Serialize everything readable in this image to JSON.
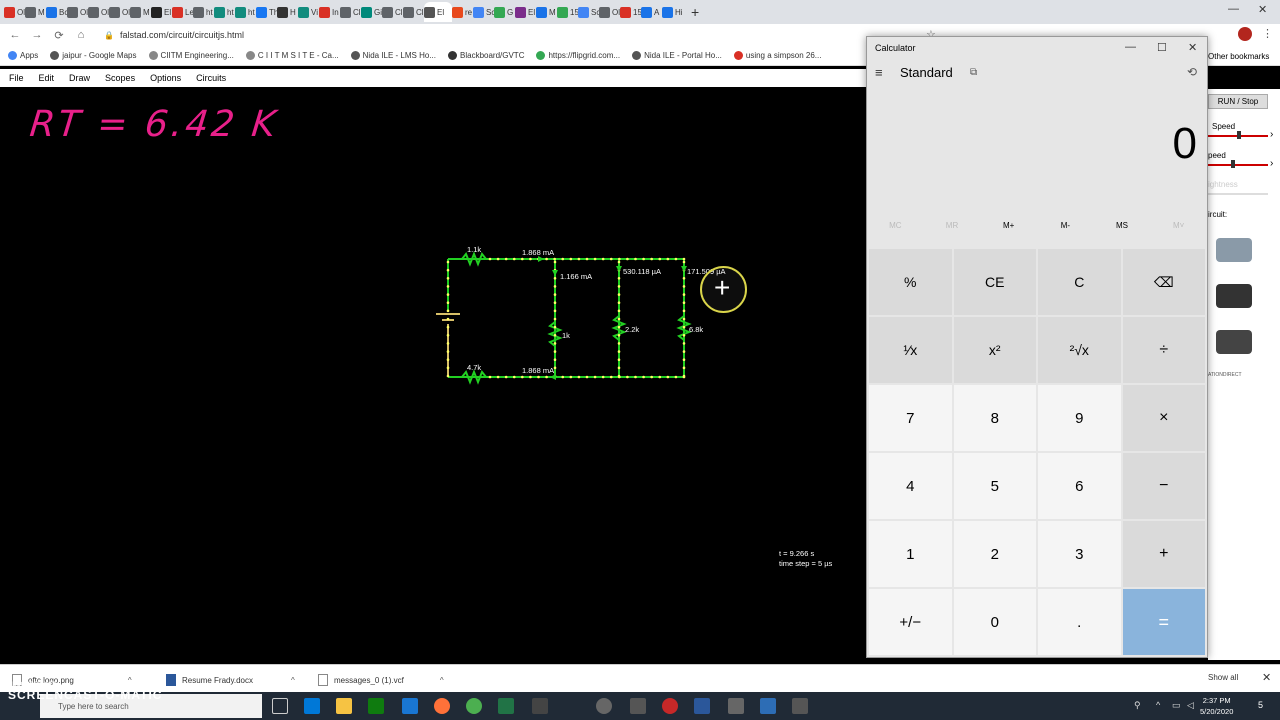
{
  "browser": {
    "tabs": [
      "Ol",
      "M",
      "Bc",
      "Ol",
      "Ol",
      "Ol",
      "M",
      "El",
      "Le",
      "ht",
      "ht",
      "ht",
      "Th",
      "H",
      "Vi",
      "In",
      "Cl",
      "Gi",
      "Cl",
      "Cl",
      "El",
      "re",
      "Sc",
      "G",
      "El",
      "M",
      "15",
      "Sc",
      "Ol",
      "15",
      "A",
      "Hi"
    ],
    "tab_colors": [
      "#d93025",
      "#5f6368",
      "#1a73e8",
      "#5f6368",
      "#5f6368",
      "#5f6368",
      "#5f6368",
      "#222",
      "#d93025",
      "#5f6368",
      "#128c7e",
      "#128c7e",
      "#1877f2",
      "#333",
      "#128c7e",
      "#d93025",
      "#5f6368",
      "#00897b",
      "#5f6368",
      "#5f6368",
      "#555",
      "#e8491d",
      "#4285f4",
      "#34a853",
      "#7b2d8b",
      "#1a73e8",
      "#34a853",
      "#4285f4",
      "#5f6368",
      "#d93025",
      "#1a73e8",
      "#1a73e8"
    ],
    "new_tab": "+",
    "url": "falstad.com/circuit/circuitjs.html",
    "bookmarks": [
      {
        "label": "Apps",
        "color": "#4285f4"
      },
      {
        "label": "jaipur - Google Maps",
        "color": "#555"
      },
      {
        "label": "CIITM Engineering...",
        "color": "#888"
      },
      {
        "label": "C I I T M S I T E - Ca...",
        "color": "#888"
      },
      {
        "label": "Nida ILE - LMS Ho...",
        "color": "#555"
      },
      {
        "label": "Blackboard/GVTC",
        "color": "#333"
      },
      {
        "label": "https://flipgrid.com...",
        "color": "#34a853"
      },
      {
        "label": "Nida ILE - Portal Ho...",
        "color": "#555"
      },
      {
        "label": "using a simpson 26...",
        "color": "#d93025"
      }
    ],
    "other_bookmarks": "Other bookmarks"
  },
  "falstad": {
    "menu": [
      "File",
      "Edit",
      "Draw",
      "Scopes",
      "Options",
      "Circuits"
    ],
    "annotation": "RT = 6.42 K",
    "circuit": {
      "labels": {
        "r1": "1.1k",
        "r2": "4.7k",
        "r3": "1k",
        "r4": "2.2k",
        "r5": "6.8k",
        "i_top": "1.868 mA",
        "i_bottom": "1.868 mA",
        "i_1k": "1.166 mA",
        "i_22k": "530.118 µA",
        "i_68k": "171.509 µA"
      }
    },
    "sim_time": "t = 9.266 s",
    "time_step": "time step = 5 µs",
    "side": {
      "run": "RUN / Stop",
      "speed1": "Speed",
      "speed2": "peed",
      "brightness": "ightness",
      "circuit_label": "ircuit:",
      "ad_text": "ATIONDIRECT"
    }
  },
  "calculator": {
    "title": "Calculator",
    "mode": "Standard",
    "display": "0",
    "memory": [
      "MC",
      "MR",
      "M+",
      "M-",
      "MS",
      "M˅"
    ],
    "keys": [
      "%",
      "CE",
      "C",
      "⌫",
      "¹⁄x",
      "x²",
      "²√x",
      "÷",
      "7",
      "8",
      "9",
      "×",
      "4",
      "5",
      "6",
      "−",
      "1",
      "2",
      "3",
      "+",
      "+/−",
      "0",
      ".",
      "="
    ]
  },
  "downloads": [
    {
      "name": "oftc logo.png"
    },
    {
      "name": "Resume Frady.docx"
    },
    {
      "name": "messages_0 (1).vcf"
    }
  ],
  "show_all": "Show all",
  "taskbar": {
    "search_placeholder": "Type here to search",
    "time": "2:37 PM",
    "date": "5/20/2020",
    "notif_count": "5"
  },
  "watermark": {
    "line1": "RECORDED WITH",
    "line2": "SCREENCAST-O-MATIC"
  }
}
